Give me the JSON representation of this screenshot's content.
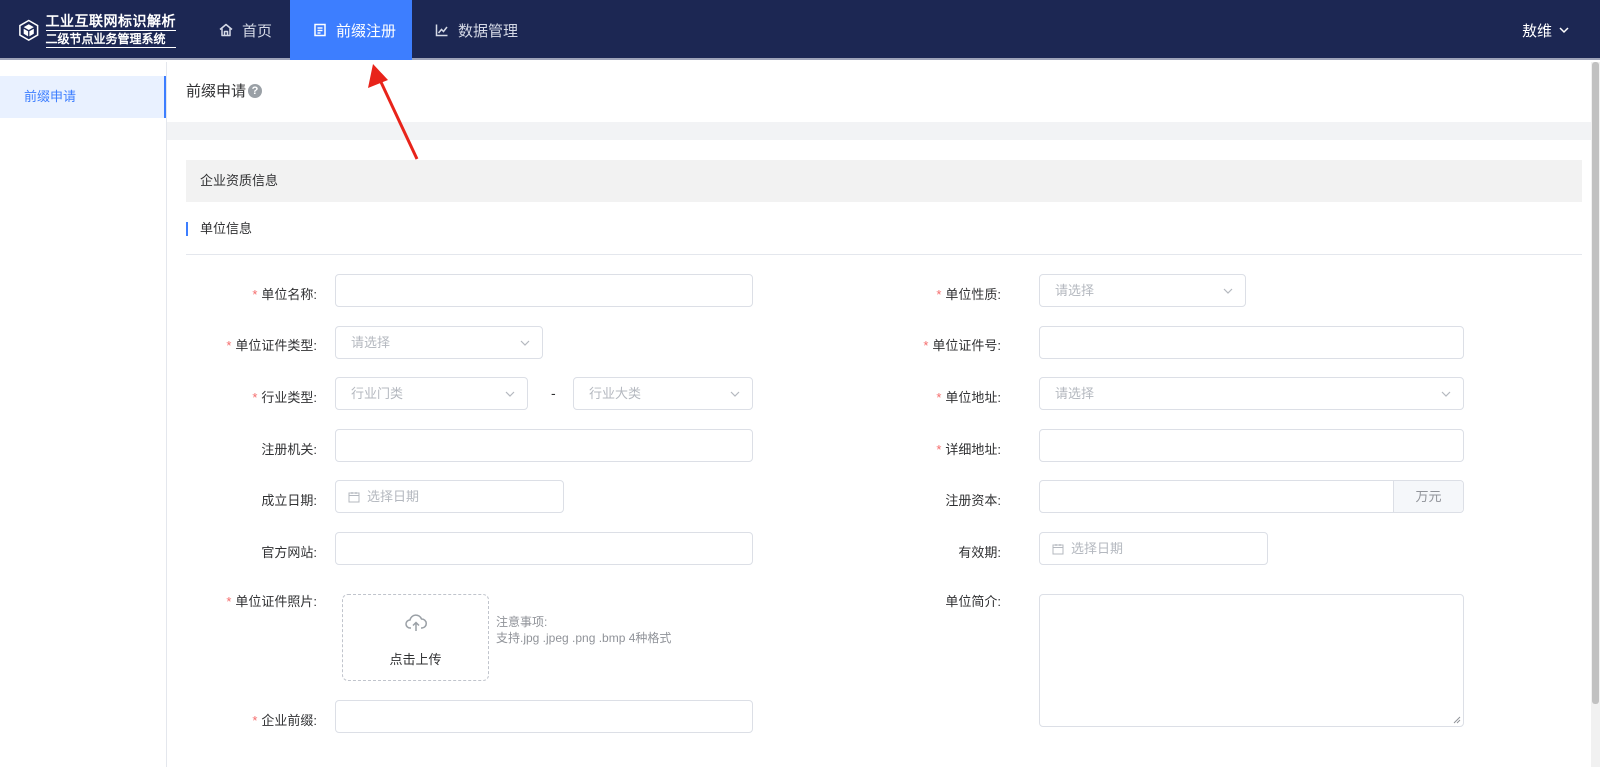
{
  "header": {
    "logo_line1": "工业互联网标识解析",
    "logo_line2": "二级节点业务管理系统",
    "nav": [
      {
        "label": "首页",
        "icon": "home-icon"
      },
      {
        "label": "前缀注册",
        "icon": "document-icon"
      },
      {
        "label": "数据管理",
        "icon": "chart-line-icon"
      }
    ],
    "user_name": "敖维"
  },
  "sidebar": {
    "items": [
      {
        "label": "前缀申请"
      }
    ]
  },
  "page": {
    "title": "前缀申请",
    "help": "?",
    "section": "企业资质信息",
    "subsection": "单位信息"
  },
  "form": {
    "required_mark": "*",
    "unit_name_label": "单位名称:",
    "unit_nature_label": "单位性质:",
    "unit_nature_placeholder": "请选择",
    "cert_type_label": "单位证件类型:",
    "cert_type_placeholder": "请选择",
    "cert_no_label": "单位证件号:",
    "industry_label": "行业类型:",
    "industry_category_placeholder": "行业门类",
    "industry_major_placeholder": "行业大类",
    "industry_sep": "-",
    "address_label": "单位地址:",
    "address_placeholder": "请选择",
    "reg_authority_label": "注册机关:",
    "detail_address_label": "详细地址:",
    "found_date_label": "成立日期:",
    "found_date_placeholder": "选择日期",
    "reg_capital_label": "注册资本:",
    "reg_capital_unit": "万元",
    "website_label": "官方网站:",
    "validity_label": "有效期:",
    "validity_placeholder": "选择日期",
    "cert_photo_label": "单位证件照片:",
    "upload_text": "点击上传",
    "note_title": "注意事项:",
    "note_text": "支持.jpg .jpeg .png .bmp 4种格式",
    "intro_label": "单位简介:",
    "prefix_label": "企业前缀:"
  },
  "colors": {
    "header_bg": "#1c2753",
    "accent": "#3d7eff",
    "required": "#f56c6c",
    "annotation_arrow": "#e8231a"
  }
}
